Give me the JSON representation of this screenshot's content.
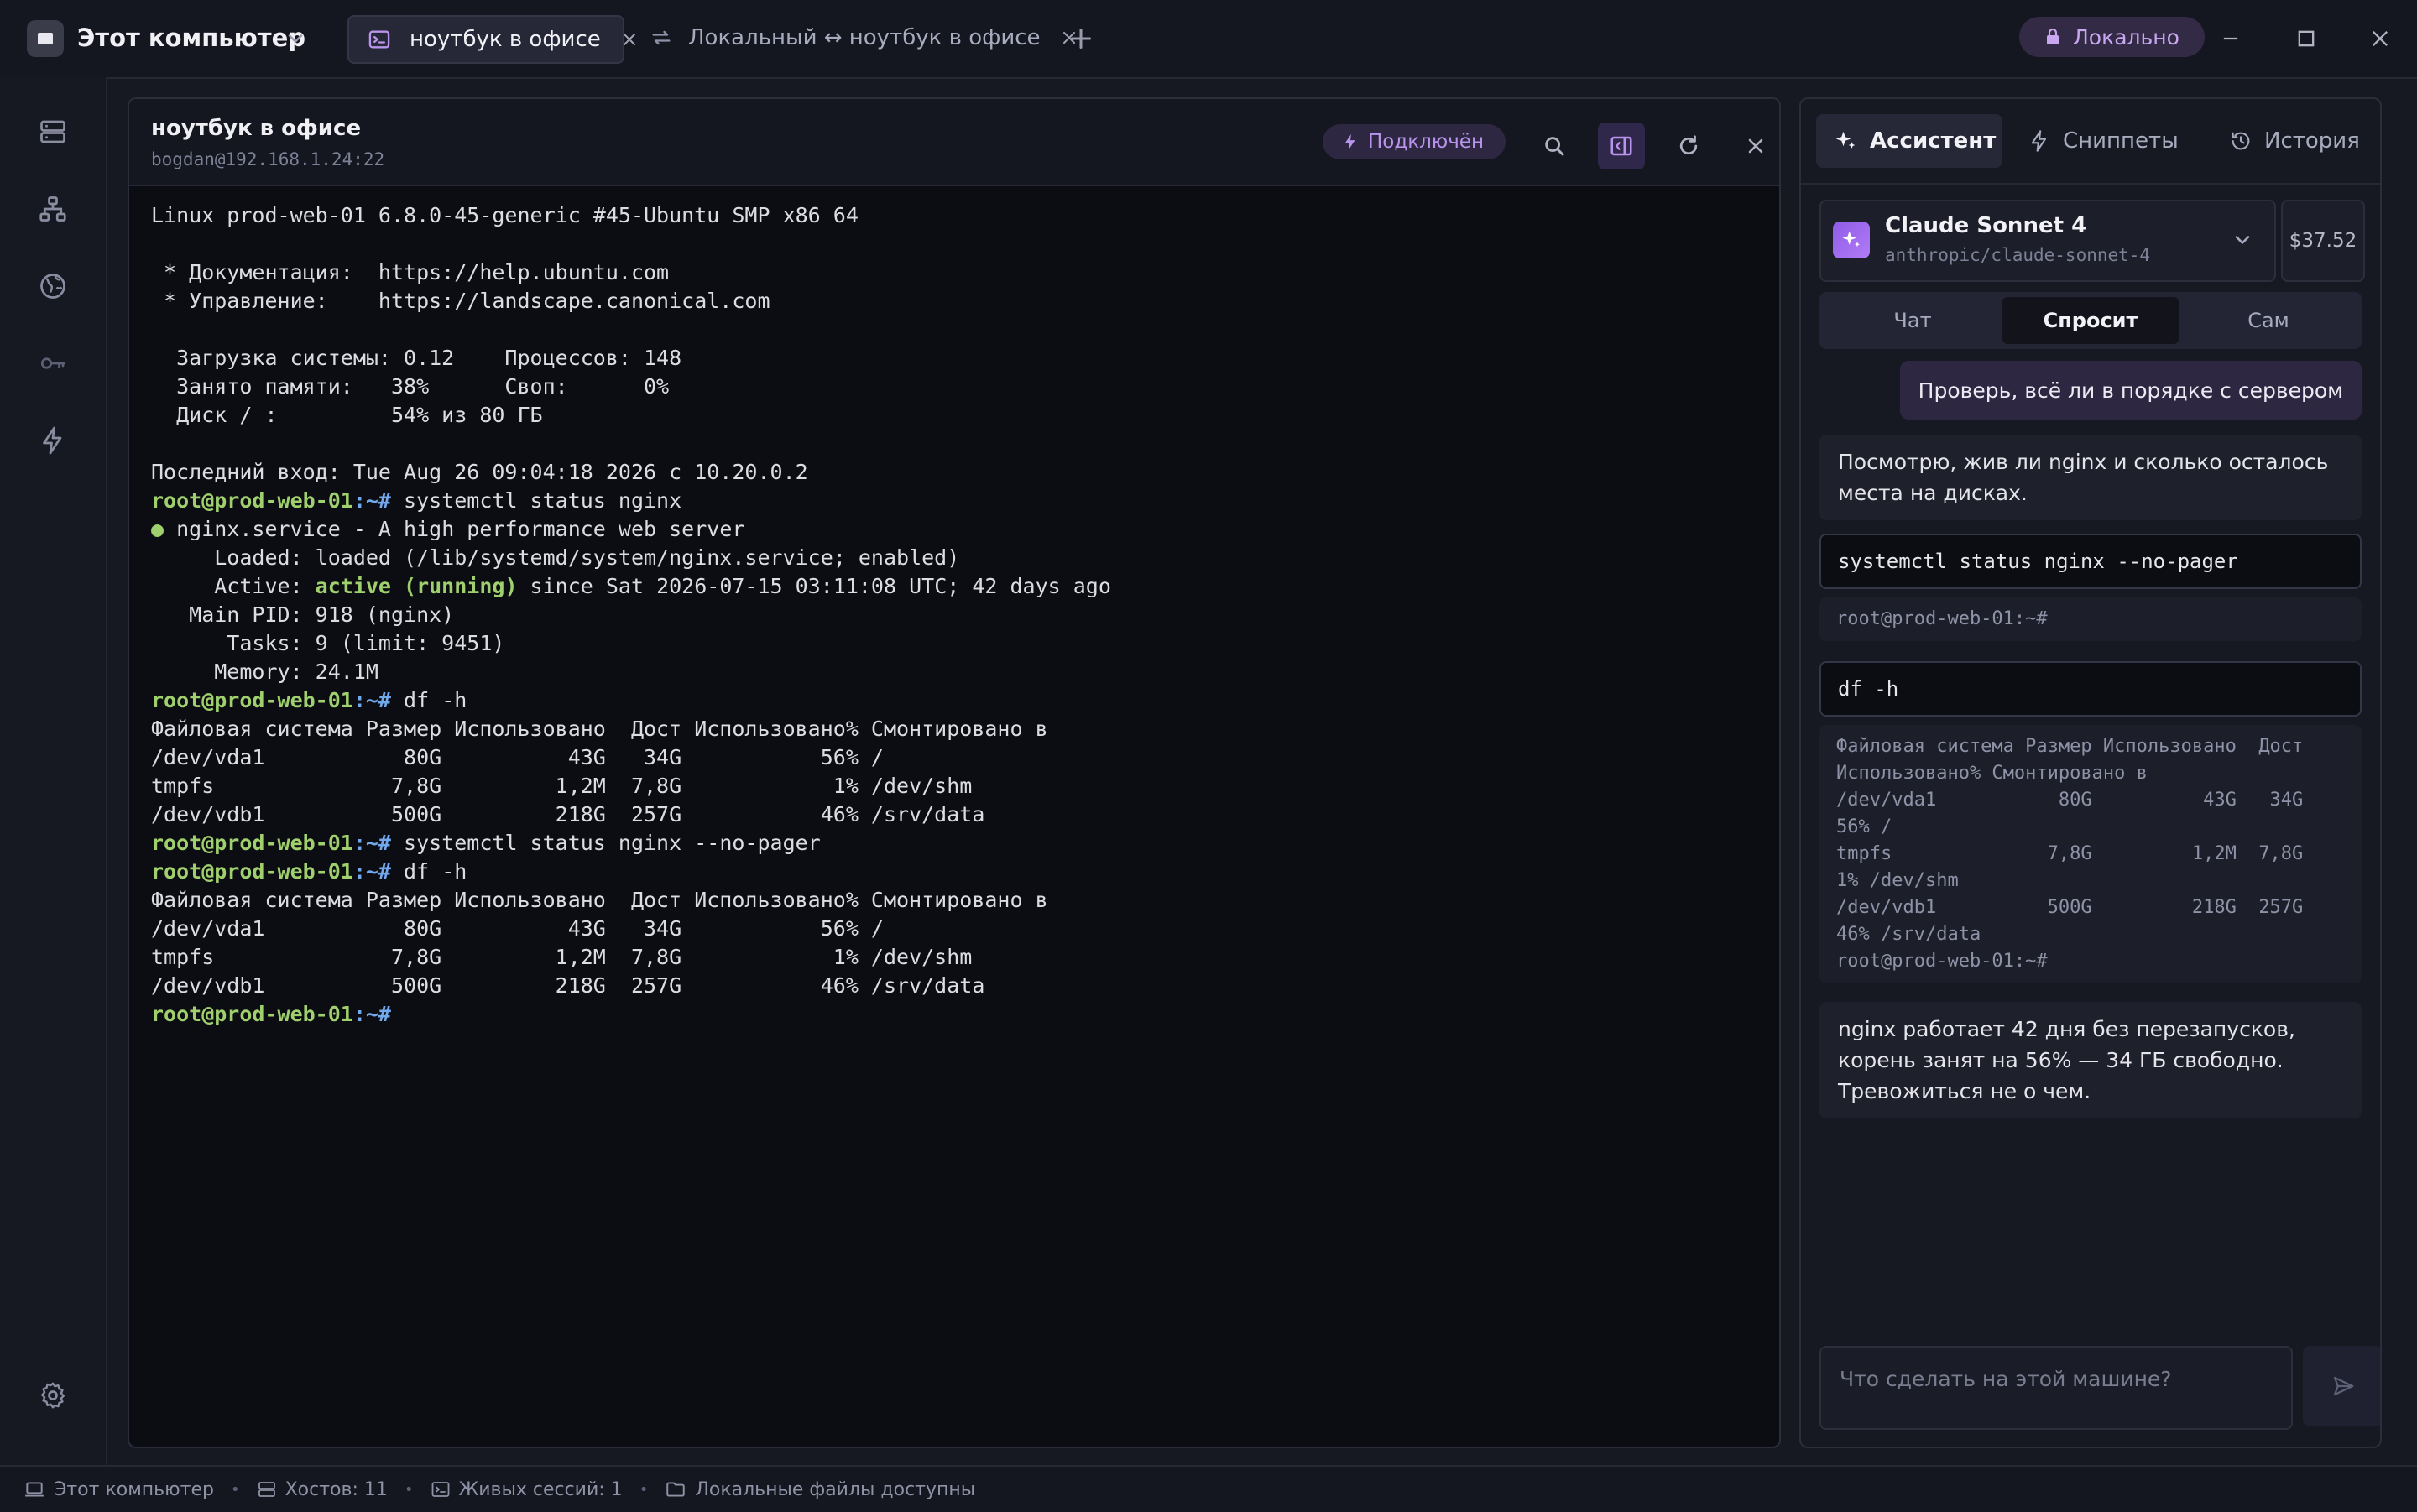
{
  "titlebar": {
    "host_selector": "Этот компьютер",
    "tabs": [
      {
        "label": "ноутбук в офисе",
        "icon": "terminal-icon",
        "active": true
      },
      {
        "label": "Локальный ↔ ноутбук в офисе",
        "icon": "transfer-icon",
        "active": false
      }
    ],
    "locality_badge": "Локально"
  },
  "terminal_panel": {
    "title": "ноутбук в офисе",
    "subtitle": "bogdan@192.168.1.24:22",
    "status": "Подключён",
    "prompt_user": "root@prod-web-01",
    "prompt_path": ":~#",
    "lines": {
      "l1": "Linux prod-web-01 6.8.0-45-generic #45-Ubuntu SMP x86_64",
      "l2": " * Документация:  https://help.ubuntu.com",
      "l3": " * Управление:    https://landscape.canonical.com",
      "l4": "  Загрузка системы: 0.12    Процессов: 148",
      "l5": "  Занято памяти:   38%      Своп:      0%",
      "l6": "  Диск / :         54% из 80 ГБ",
      "l7": "Последний вход: Tue Aug 26 09:04:18 2026 с 10.20.0.2",
      "c1": " systemctl status nginx",
      "s1_dot": "●",
      "s1": " nginx.service - A high performance web server",
      "s2": "     Loaded: loaded (/lib/systemd/system/nginx.service; enabled)",
      "s3_pre": "     Active: ",
      "s3_green": "active (running)",
      "s3_post": " since Sat 2026-07-15 03:11:08 UTC; 42 days ago",
      "s4": "   Main PID: 918 (nginx)",
      "s5": "      Tasks: 9 (limit: 9451)",
      "s6": "     Memory: 24.1M",
      "c2": " df -h",
      "d_head": "Файловая система Размер Использовано  Дост Использовано% Смонтировано в",
      "d1": "/dev/vda1           80G          43G   34G           56% /",
      "d2": "tmpfs              7,8G         1,2M  7,8G            1% /dev/shm",
      "d3": "/dev/vdb1          500G         218G  257G           46% /srv/data",
      "c3": " systemctl status nginx --no-pager",
      "c4": " df -h"
    }
  },
  "assistant": {
    "tabs": [
      "Ассистент",
      "Сниппеты",
      "История"
    ],
    "model_name": "Claude Sonnet 4",
    "model_id": "anthropic/claude-sonnet-4",
    "cost": "$37.52",
    "modes": [
      "Чат",
      "Спросит",
      "Сам"
    ],
    "active_mode": "Спросит",
    "user_message": "Проверь, всё ли в порядке с сервером",
    "bot_message_1": "Посмотрю, жив ли nginx и сколько осталось места на дисках.",
    "cmd_1": "systemctl status nginx --no-pager",
    "out_1": "root@prod-web-01:~#",
    "cmd_2": "df -h",
    "out_2": "Файловая система Размер Использовано  Дост\nИспользовано% Смонтировано в\n/dev/vda1           80G          43G   34G\n56% /\ntmpfs              7,8G         1,2M  7,8G\n1% /dev/shm\n/dev/vdb1          500G         218G  257G\n46% /srv/data\nroot@prod-web-01:~#",
    "bot_message_2": "nginx работает 42 дня без перезапусков, корень занят на 56% — 34 ГБ свободно. Тревожиться не о чем.",
    "input_placeholder": "Что сделать на этой машине?"
  },
  "statusbar": {
    "computer": "Этот компьютер",
    "hosts": "Хостов: 11",
    "sessions": "Живых сессий: 1",
    "files": "Локальные файлы доступны"
  },
  "colors": {
    "accent": "#b994ec",
    "prompt_green": "#9fd06d",
    "prompt_blue": "#72a8ec",
    "background": "#161822"
  }
}
